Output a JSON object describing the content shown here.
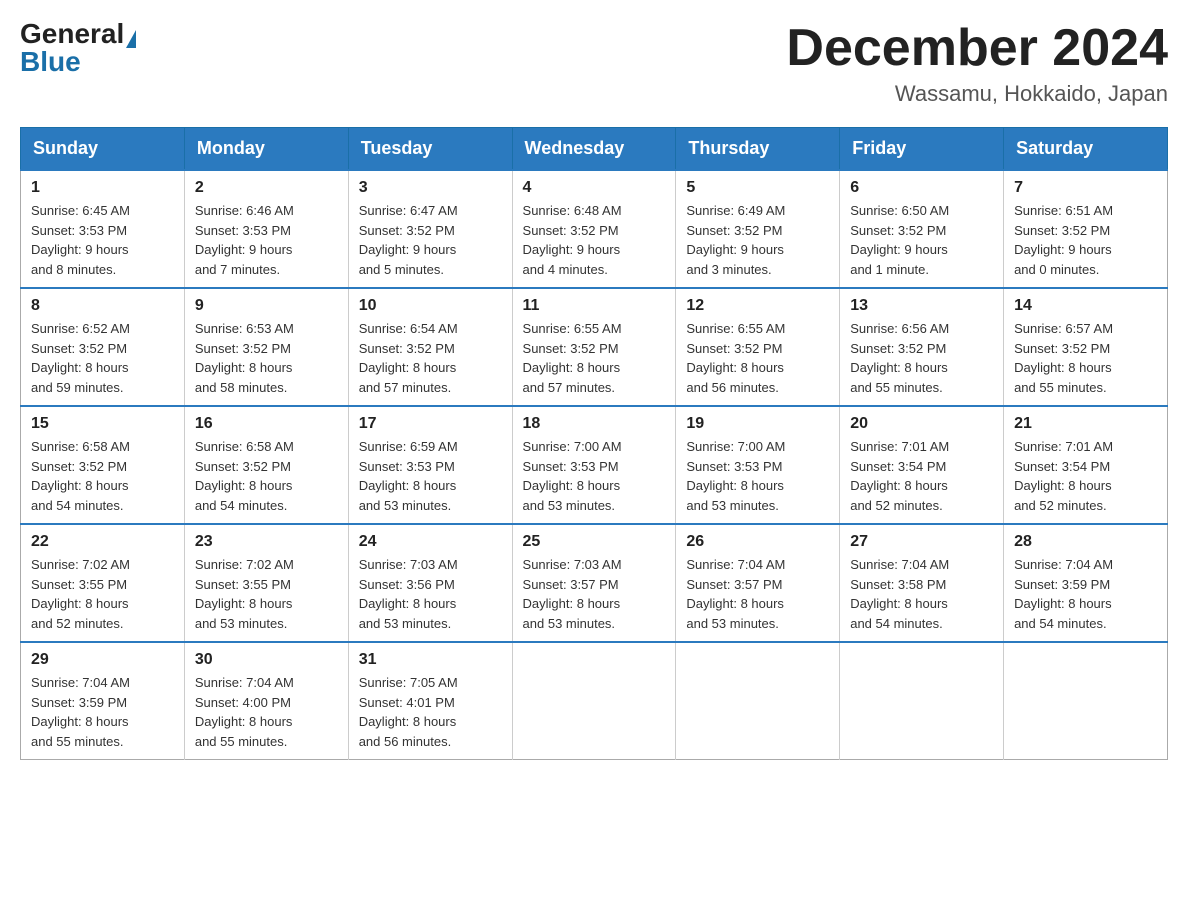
{
  "logo": {
    "general": "General",
    "blue": "Blue"
  },
  "title": "December 2024",
  "location": "Wassamu, Hokkaido, Japan",
  "days_of_week": [
    "Sunday",
    "Monday",
    "Tuesday",
    "Wednesday",
    "Thursday",
    "Friday",
    "Saturday"
  ],
  "weeks": [
    [
      {
        "day": "1",
        "sunrise": "6:45 AM",
        "sunset": "3:53 PM",
        "daylight": "9 hours and 8 minutes."
      },
      {
        "day": "2",
        "sunrise": "6:46 AM",
        "sunset": "3:53 PM",
        "daylight": "9 hours and 7 minutes."
      },
      {
        "day": "3",
        "sunrise": "6:47 AM",
        "sunset": "3:52 PM",
        "daylight": "9 hours and 5 minutes."
      },
      {
        "day": "4",
        "sunrise": "6:48 AM",
        "sunset": "3:52 PM",
        "daylight": "9 hours and 4 minutes."
      },
      {
        "day": "5",
        "sunrise": "6:49 AM",
        "sunset": "3:52 PM",
        "daylight": "9 hours and 3 minutes."
      },
      {
        "day": "6",
        "sunrise": "6:50 AM",
        "sunset": "3:52 PM",
        "daylight": "9 hours and 1 minute."
      },
      {
        "day": "7",
        "sunrise": "6:51 AM",
        "sunset": "3:52 PM",
        "daylight": "9 hours and 0 minutes."
      }
    ],
    [
      {
        "day": "8",
        "sunrise": "6:52 AM",
        "sunset": "3:52 PM",
        "daylight": "8 hours and 59 minutes."
      },
      {
        "day": "9",
        "sunrise": "6:53 AM",
        "sunset": "3:52 PM",
        "daylight": "8 hours and 58 minutes."
      },
      {
        "day": "10",
        "sunrise": "6:54 AM",
        "sunset": "3:52 PM",
        "daylight": "8 hours and 57 minutes."
      },
      {
        "day": "11",
        "sunrise": "6:55 AM",
        "sunset": "3:52 PM",
        "daylight": "8 hours and 57 minutes."
      },
      {
        "day": "12",
        "sunrise": "6:55 AM",
        "sunset": "3:52 PM",
        "daylight": "8 hours and 56 minutes."
      },
      {
        "day": "13",
        "sunrise": "6:56 AM",
        "sunset": "3:52 PM",
        "daylight": "8 hours and 55 minutes."
      },
      {
        "day": "14",
        "sunrise": "6:57 AM",
        "sunset": "3:52 PM",
        "daylight": "8 hours and 55 minutes."
      }
    ],
    [
      {
        "day": "15",
        "sunrise": "6:58 AM",
        "sunset": "3:52 PM",
        "daylight": "8 hours and 54 minutes."
      },
      {
        "day": "16",
        "sunrise": "6:58 AM",
        "sunset": "3:52 PM",
        "daylight": "8 hours and 54 minutes."
      },
      {
        "day": "17",
        "sunrise": "6:59 AM",
        "sunset": "3:53 PM",
        "daylight": "8 hours and 53 minutes."
      },
      {
        "day": "18",
        "sunrise": "7:00 AM",
        "sunset": "3:53 PM",
        "daylight": "8 hours and 53 minutes."
      },
      {
        "day": "19",
        "sunrise": "7:00 AM",
        "sunset": "3:53 PM",
        "daylight": "8 hours and 53 minutes."
      },
      {
        "day": "20",
        "sunrise": "7:01 AM",
        "sunset": "3:54 PM",
        "daylight": "8 hours and 52 minutes."
      },
      {
        "day": "21",
        "sunrise": "7:01 AM",
        "sunset": "3:54 PM",
        "daylight": "8 hours and 52 minutes."
      }
    ],
    [
      {
        "day": "22",
        "sunrise": "7:02 AM",
        "sunset": "3:55 PM",
        "daylight": "8 hours and 52 minutes."
      },
      {
        "day": "23",
        "sunrise": "7:02 AM",
        "sunset": "3:55 PM",
        "daylight": "8 hours and 53 minutes."
      },
      {
        "day": "24",
        "sunrise": "7:03 AM",
        "sunset": "3:56 PM",
        "daylight": "8 hours and 53 minutes."
      },
      {
        "day": "25",
        "sunrise": "7:03 AM",
        "sunset": "3:57 PM",
        "daylight": "8 hours and 53 minutes."
      },
      {
        "day": "26",
        "sunrise": "7:04 AM",
        "sunset": "3:57 PM",
        "daylight": "8 hours and 53 minutes."
      },
      {
        "day": "27",
        "sunrise": "7:04 AM",
        "sunset": "3:58 PM",
        "daylight": "8 hours and 54 minutes."
      },
      {
        "day": "28",
        "sunrise": "7:04 AM",
        "sunset": "3:59 PM",
        "daylight": "8 hours and 54 minutes."
      }
    ],
    [
      {
        "day": "29",
        "sunrise": "7:04 AM",
        "sunset": "3:59 PM",
        "daylight": "8 hours and 55 minutes."
      },
      {
        "day": "30",
        "sunrise": "7:04 AM",
        "sunset": "4:00 PM",
        "daylight": "8 hours and 55 minutes."
      },
      {
        "day": "31",
        "sunrise": "7:05 AM",
        "sunset": "4:01 PM",
        "daylight": "8 hours and 56 minutes."
      },
      null,
      null,
      null,
      null
    ]
  ]
}
